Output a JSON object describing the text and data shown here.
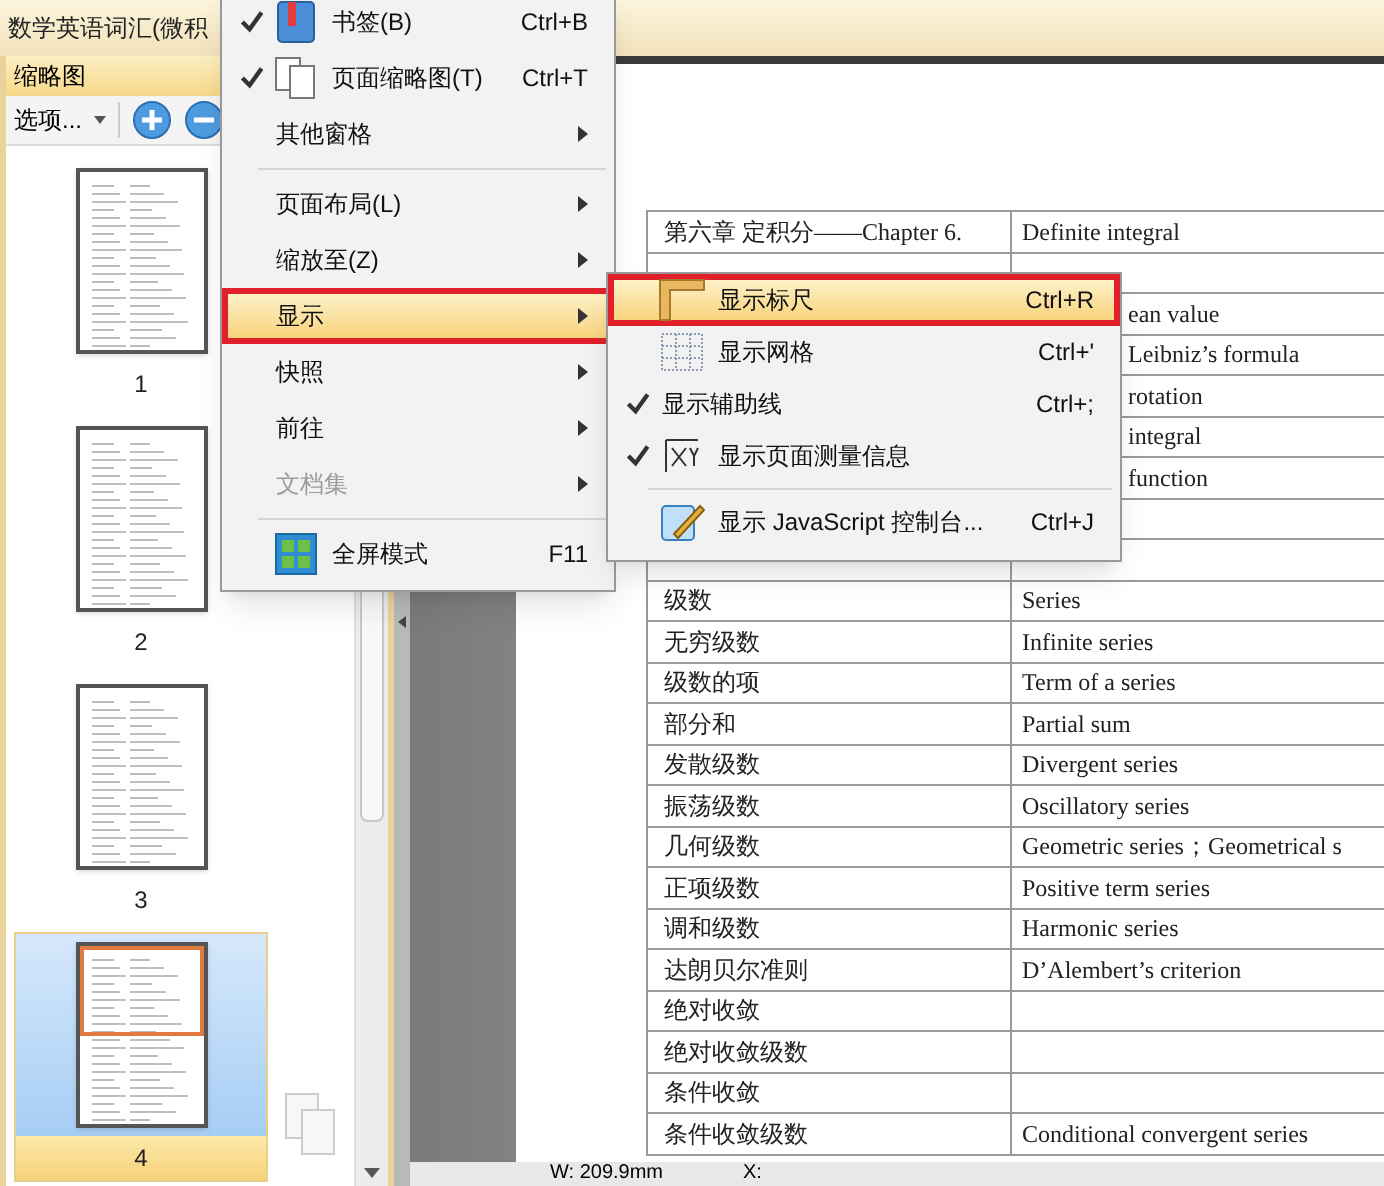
{
  "window": {
    "title": "数学英语词汇(微积"
  },
  "panel": {
    "title": "缩略图",
    "options": "选项...",
    "thumbnails": [
      {
        "label": "1",
        "selected": false
      },
      {
        "label": "2",
        "selected": false
      },
      {
        "label": "3",
        "selected": false
      },
      {
        "label": "4",
        "selected": true
      }
    ]
  },
  "table": {
    "rows": [
      {
        "left": "第六章  定积分——Chapter 6.",
        "right": "Definite integral"
      },
      {},
      {
        "right": "ean value"
      },
      {
        "right": "Leibniz’s formula"
      },
      {
        "right": "rotation"
      },
      {
        "right": "integral"
      },
      {
        "right": "function"
      },
      {},
      {},
      {
        "left": "级数",
        "right": "Series"
      },
      {
        "left": "无穷级数",
        "right": "Infinite series"
      },
      {
        "left": "级数的项",
        "right": "Term of a series"
      },
      {
        "left": "部分和",
        "right": "Partial sum"
      },
      {
        "left": "发散级数",
        "right": "Divergent series"
      },
      {
        "left": "振荡级数",
        "right": "Oscillatory series"
      },
      {
        "left": "几何级数",
        "right": "Geometric series；Geometrical s"
      },
      {
        "left": "正项级数",
        "right": "Positive term series"
      },
      {
        "left": "调和级数",
        "right": "Harmonic series"
      },
      {
        "left": "达朗贝尔准则",
        "right": "D’Alembert’s criterion"
      },
      {
        "left": "绝对收敛"
      },
      {
        "left": "绝对收敛级数"
      },
      {
        "left": "条件收敛"
      },
      {
        "left": "条件收敛级数",
        "right": "Conditional convergent series"
      }
    ]
  },
  "menu": {
    "items": [
      {
        "kind": "item",
        "label": "书签(B)",
        "shortcut": "Ctrl+B",
        "checked": true,
        "selected": false,
        "disabled": false,
        "submenu": false
      },
      {
        "kind": "item",
        "label": "页面缩略图(T)",
        "shortcut": "Ctrl+T",
        "checked": true,
        "selected": false,
        "disabled": false,
        "submenu": false
      },
      {
        "kind": "item",
        "label": "其他窗格",
        "selected": false,
        "disabled": false,
        "submenu": true
      },
      {
        "kind": "separator"
      },
      {
        "kind": "item",
        "label": "页面布局(L)",
        "selected": false,
        "disabled": false,
        "submenu": true
      },
      {
        "kind": "item",
        "label": "缩放至(Z)",
        "selected": false,
        "disabled": false,
        "submenu": true
      },
      {
        "kind": "item",
        "label": "显示",
        "selected": true,
        "disabled": false,
        "submenu": true
      },
      {
        "kind": "item",
        "label": "快照",
        "selected": false,
        "disabled": false,
        "submenu": true
      },
      {
        "kind": "item",
        "label": "前往",
        "selected": false,
        "disabled": false,
        "submenu": true
      },
      {
        "kind": "item",
        "label": "文档集",
        "selected": false,
        "disabled": true,
        "submenu": true
      },
      {
        "kind": "separator"
      },
      {
        "kind": "item",
        "label": "全屏模式",
        "shortcut": "F11",
        "selected": false,
        "disabled": false,
        "submenu": false
      }
    ]
  },
  "submenu": {
    "items": [
      {
        "kind": "item",
        "label": "显示标尺",
        "shortcut": "Ctrl+R",
        "checked": false,
        "selected": true
      },
      {
        "kind": "item",
        "label": "显示网格",
        "shortcut": "Ctrl+'",
        "checked": false,
        "selected": false
      },
      {
        "kind": "item",
        "label": "显示辅助线",
        "shortcut": "Ctrl+;",
        "checked": true,
        "selected": false
      },
      {
        "kind": "item",
        "label": "显示页面测量信息",
        "checked": true,
        "selected": false
      },
      {
        "kind": "separator"
      },
      {
        "kind": "item",
        "label": "显示 JavaScript 控制台...",
        "shortcut": "Ctrl+J",
        "checked": false,
        "selected": false
      }
    ]
  },
  "status_bar": {
    "width": "W: 209.9mm",
    "x": "X:"
  }
}
